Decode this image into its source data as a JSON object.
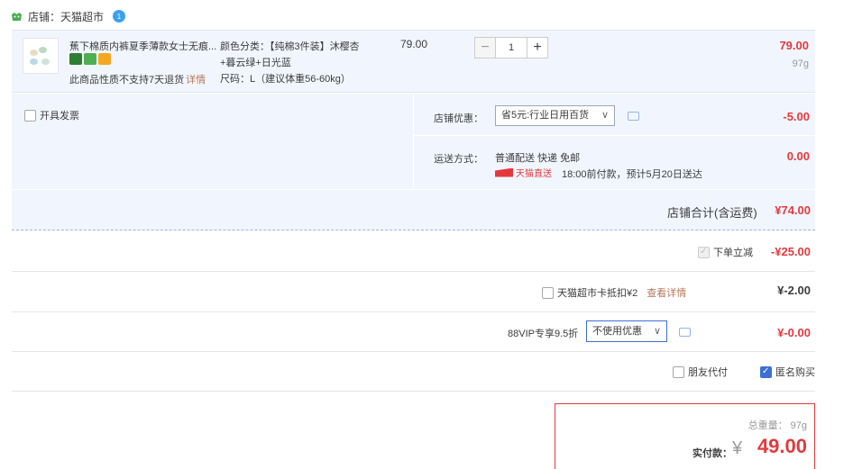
{
  "shop": {
    "label": "店铺：天猫超市",
    "wangwang_badge": "1"
  },
  "product": {
    "title": "蕉下棉质内裤夏季薄款女士无痕...",
    "no_return": "此商品性质不支持7天退货",
    "detail_link": "详情",
    "sku_color": "颜色分类：【纯棉3件装】沐樱杏",
    "sku_color_cont": "+暮云绿+日光蓝",
    "sku_size": "尺码：L（建议体重56-60kg）",
    "unit_price": "79.00",
    "quantity": "1",
    "subtotal": "79.00",
    "weight": "97g"
  },
  "options": {
    "invoice_label": "开具发票",
    "coupon_label": "店铺优惠：",
    "coupon_selected": "省5元:行业日用百货",
    "coupon_amount": "-5.00",
    "shipping_label": "运送方式：",
    "shipping_method": "普通配送 快递 免邮",
    "shipping_amount": "0.00",
    "tmzs_label": "天猫直送",
    "shipping_eta": "18:00前付款，预计5月20日送达",
    "shop_total_label": "店铺合计(含运费)",
    "shop_total": "¥74.00"
  },
  "discounts": {
    "instant_label": "下单立减",
    "instant_amount": "-¥25.00",
    "card_label": "天猫超市卡抵扣¥2",
    "card_link": "查看详情",
    "card_amount": "¥-2.00",
    "vip_label": "88VIP专享9.5折",
    "vip_selected": "不使用优惠",
    "vip_amount": "¥-0.00",
    "friend_pay_label": "朋友代付",
    "anonymous_label": "匿名购买"
  },
  "total": {
    "weight_text": "总重量：  97g",
    "pay_label": "实付款：",
    "currency": "¥",
    "amount": "49.00"
  }
}
